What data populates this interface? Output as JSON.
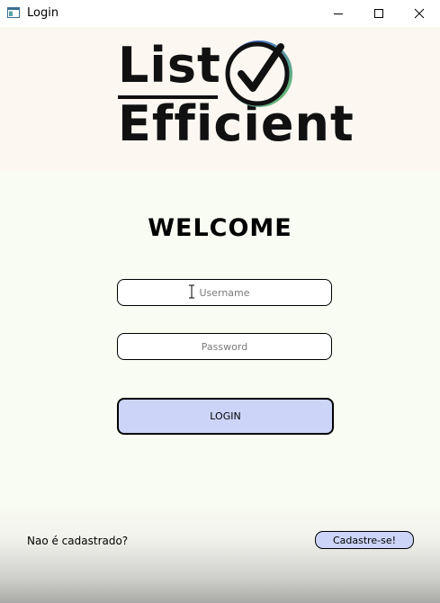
{
  "window": {
    "title": "Login",
    "app_icon": "window-app-icon",
    "controls": [
      "minimize-icon",
      "maximize-icon",
      "close-icon"
    ]
  },
  "logo": {
    "line1": "List",
    "line2": "Efficient",
    "mark": "checkmark-circle-icon"
  },
  "form": {
    "heading": "WELCOME",
    "username_placeholder": "Username",
    "password_placeholder": "Password",
    "login_label": "LOGIN"
  },
  "footer": {
    "prompt": "Nao é cadastrado?",
    "signup_label": "Cadastre-se!"
  },
  "colors": {
    "header_bg": "#fcf7f1",
    "body_bg": "#f9fcf2",
    "button_bg": "#ccd5f8",
    "logo_ring_gradient": [
      "#3b5bdb",
      "#6ec56b"
    ]
  }
}
